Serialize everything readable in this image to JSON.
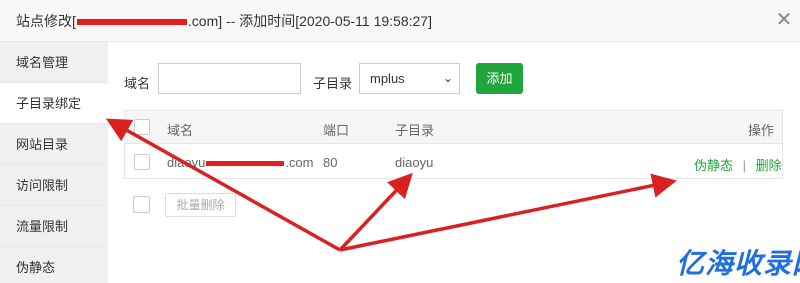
{
  "window": {
    "title_prefix": "站点修改[",
    "title_suffix": ".com] -- 添加时间[2020-05-11 19:58:27]",
    "close_icon": "close-icon"
  },
  "sidebar": {
    "items": [
      {
        "label": "域名管理"
      },
      {
        "label": "子目录绑定"
      },
      {
        "label": "网站目录"
      },
      {
        "label": "访问限制"
      },
      {
        "label": "流量限制"
      },
      {
        "label": "伪静态"
      }
    ]
  },
  "form": {
    "domain_label": "域名",
    "domain_value": "",
    "subdir_label": "子目录",
    "subdir_selected": "mplus",
    "add_button": "添加"
  },
  "table": {
    "headers": {
      "domain": "域名",
      "port": "端口",
      "subdir": "子目录",
      "action": "操作"
    },
    "rows": [
      {
        "domain_prefix": "diaoyu",
        "domain_suffix": ".com",
        "port": "80",
        "subdir": "diaoyu",
        "action_rewrite": "伪静态",
        "action_sep": "|",
        "action_delete": "删除"
      }
    ]
  },
  "batch": {
    "delete_button": "批量删除"
  },
  "watermark": {
    "text": "亿海收录网"
  },
  "colors": {
    "accent_green": "#20a53a",
    "arrow_red": "#d92121",
    "watermark_blue": "#1f6fe0"
  }
}
